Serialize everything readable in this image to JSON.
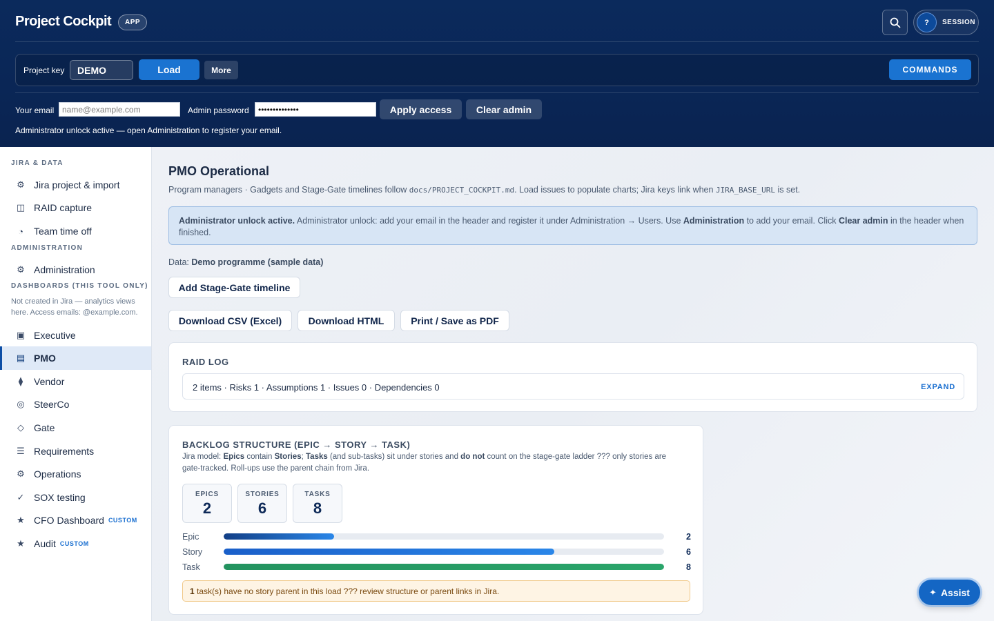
{
  "header": {
    "brand": "Project Cockpit",
    "badge": "APP",
    "session_icon": "?",
    "session_label": "SESSION",
    "search_icon": "search-icon"
  },
  "toolbar": {
    "project_key_label": "Project key",
    "project_key_value": "DEMO",
    "load_label": "Load",
    "more_label": "More",
    "commands_label": "COMMANDS"
  },
  "access": {
    "email_label": "Your email",
    "email_placeholder": "name@example.com",
    "email_value": "",
    "password_label": "Admin password",
    "password_value": "••••••••••••••",
    "apply_label": "Apply access",
    "clear_label": "Clear admin",
    "note": "Administrator unlock active — open Administration to register your email."
  },
  "sidebar": {
    "sections": [
      {
        "title": "JIRA & DATA"
      },
      {
        "title": "ADMINISTRATION"
      },
      {
        "title": "DASHBOARDS (THIS TOOL ONLY)"
      }
    ],
    "dashboards_note": "Not created in Jira — analytics views here. Access emails: @example.com.",
    "items": [
      {
        "label": "Jira project & import",
        "icon": "⚙",
        "icon_name": "gear-icon"
      },
      {
        "label": "RAID capture",
        "icon": "◫",
        "icon_name": "panel-icon"
      },
      {
        "label": "Team time off",
        "icon": "◔",
        "icon_name": "clock-icon"
      },
      {
        "label": "Administration",
        "icon": "⚙",
        "icon_name": "gear-icon"
      },
      {
        "label": "Executive",
        "icon": "▣",
        "icon_name": "square-icon"
      },
      {
        "label": "PMO",
        "icon": "▤",
        "icon_name": "list-icon"
      },
      {
        "label": "Vendor",
        "icon": "⧫",
        "icon_name": "diamond-icon"
      },
      {
        "label": "SteerCo",
        "icon": "◎",
        "icon_name": "target-icon"
      },
      {
        "label": "Gate",
        "icon": "◇",
        "icon_name": "gate-icon"
      },
      {
        "label": "Requirements",
        "icon": "☰",
        "icon_name": "menu-icon"
      },
      {
        "label": "Operations",
        "icon": "⚙",
        "icon_name": "gear-icon"
      },
      {
        "label": "SOX testing",
        "icon": "✓",
        "icon_name": "check-icon"
      },
      {
        "label": "CFO Dashboard",
        "icon": "★",
        "icon_name": "star-icon",
        "tag": "CUSTOM"
      },
      {
        "label": "Audit",
        "icon": "★",
        "icon_name": "star-icon",
        "tag": "CUSTOM"
      }
    ]
  },
  "main": {
    "title": "PMO Operational",
    "subtitle_a": "Program managers · Gadgets and Stage-Gate timelines follow ",
    "subtitle_code1": "docs/PROJECT_COCKPIT.md",
    "subtitle_b": ". Load issues to populate charts; Jira keys link when ",
    "subtitle_code2": "JIRA_BASE_URL",
    "subtitle_c": " is set.",
    "info": {
      "b1": "Administrator unlock active.",
      "t1": " Administrator unlock: add your email in the header and register it under Administration → Users. Use ",
      "b2": "Administration",
      "t2": " to add your email. Click ",
      "b3": "Clear admin",
      "t3": " in the header when finished."
    },
    "data_label": "Data: ",
    "data_value": "Demo programme (sample data)",
    "add_timeline_label": "Add Stage-Gate timeline",
    "download_csv_label": "Download CSV (Excel)",
    "download_html_label": "Download HTML",
    "print_label": "Print / Save as PDF",
    "raid": {
      "title": "RAID LOG",
      "summary": "2 items · Risks 1 · Assumptions 1 · Issues 0 · Dependencies 0",
      "expand_label": "EXPAND"
    },
    "backlog": {
      "title": "BACKLOG STRUCTURE (EPIC → STORY → TASK)",
      "desc": {
        "t1": "Jira model: ",
        "b1": "Epics",
        "t2": " contain ",
        "b2": "Stories",
        "t3": "; ",
        "b3": "Tasks",
        "t4": " (and sub-tasks) sit under stories and ",
        "b4": "do not",
        "t5": " count on the stage-gate ladder ??? only stories are gate-tracked. Roll-ups use the parent chain from Jira."
      },
      "stats": [
        {
          "label": "EPICS",
          "value": "2"
        },
        {
          "label": "STORIES",
          "value": "6"
        },
        {
          "label": "TASKS",
          "value": "8"
        }
      ],
      "bars": [
        {
          "label": "Epic",
          "value": 2,
          "display": "2",
          "color": "#123f86"
        },
        {
          "label": "Story",
          "value": 6,
          "display": "6",
          "color": "#1a5fc9"
        },
        {
          "label": "Task",
          "value": 8,
          "display": "8",
          "color": "#23935f"
        }
      ],
      "bar_max": 8,
      "warning": {
        "b": "1",
        "t": " task(s) have no story parent in this load ??? review structure or parent links in Jira."
      }
    },
    "assist_label": "Assist"
  }
}
